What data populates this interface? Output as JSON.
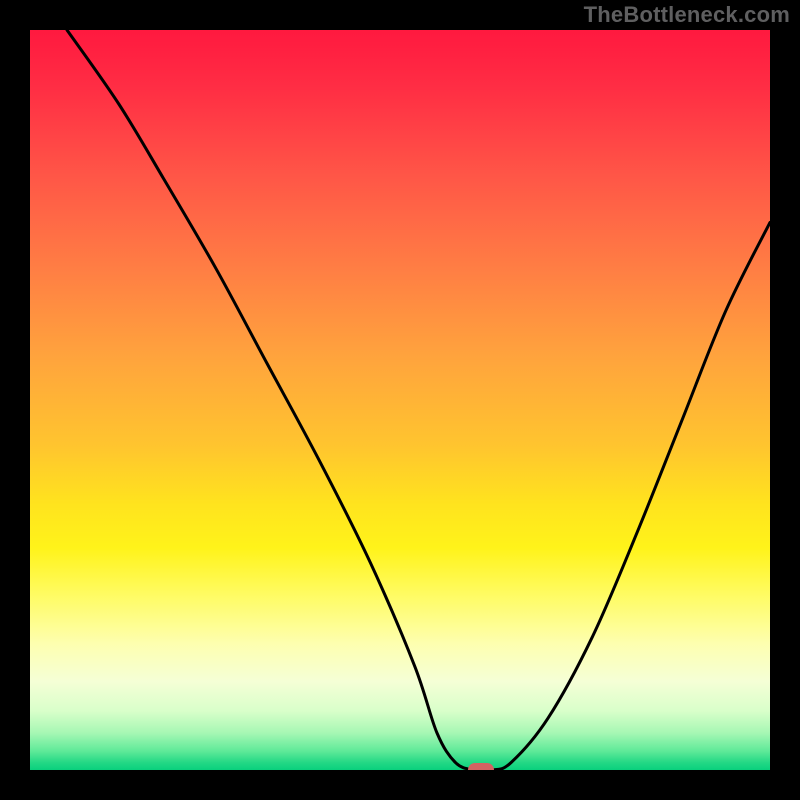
{
  "watermark": "TheBottleneck.com",
  "colors": {
    "frame": "#000000",
    "watermark_text": "#5f5f60",
    "curve_stroke": "#000000",
    "marker_fill": "#d46262",
    "gradient_stops": [
      "#ff193f",
      "#ff2e44",
      "#ff5747",
      "#ff7d44",
      "#ffa33d",
      "#ffc42f",
      "#ffe31e",
      "#fff31a",
      "#fffb5f",
      "#fdffb0",
      "#f5ffd6",
      "#d9ffca",
      "#a6f7b4",
      "#5de998",
      "#23d885",
      "#09d07d"
    ]
  },
  "chart_data": {
    "type": "line",
    "title": "",
    "xlabel": "",
    "ylabel": "",
    "xlim": [
      0,
      100
    ],
    "ylim": [
      0,
      100
    ],
    "grid": false,
    "legend": false,
    "description": "Black V-shaped bottleneck curve over vertical red→yellow→green gradient. Y is mismatch %; color bands encode same %; x is unlabeled parameter. Minimum reached at marker.",
    "series": [
      {
        "name": "bottleneck-curve",
        "x": [
          5,
          12,
          18,
          25,
          32,
          39,
          46,
          52,
          55,
          57.5,
          60,
          62.5,
          65,
          70,
          76,
          82,
          88,
          94,
          100
        ],
        "values": [
          100,
          90,
          80,
          68,
          55,
          42,
          28,
          14,
          5,
          1,
          0,
          0,
          1,
          7,
          18,
          32,
          47,
          62,
          74
        ]
      }
    ],
    "marker": {
      "x": 61,
      "y": 0
    },
    "color_bands": [
      {
        "ylo": 0,
        "yhi": 3,
        "label": "green"
      },
      {
        "ylo": 3,
        "yhi": 18,
        "label": "pale-yellow"
      },
      {
        "ylo": 18,
        "yhi": 55,
        "label": "yellow-orange"
      },
      {
        "ylo": 55,
        "yhi": 100,
        "label": "red"
      }
    ]
  }
}
